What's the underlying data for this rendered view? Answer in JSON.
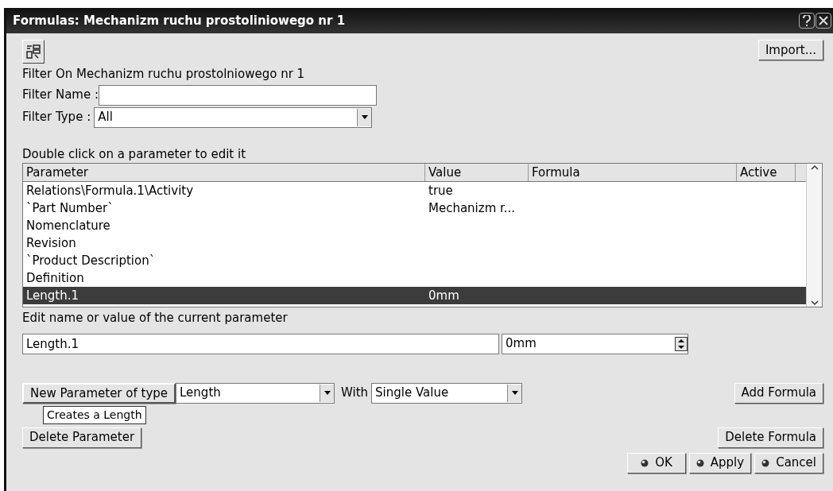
{
  "window": {
    "title": "Formulas: Mechanizm ruchu prostoliniowego nr 1"
  },
  "import_button": "Import...",
  "filter": {
    "heading": "Filter On Mechanizm ruchu prostolniowego nr 1",
    "name_label": "Filter Name :",
    "type_label": "Filter Type :",
    "type_value": "All"
  },
  "table": {
    "hint": "Double click on a parameter to edit it",
    "columns": [
      "Parameter",
      "Value",
      "Formula",
      "Active"
    ],
    "rows": [
      {
        "parameter": "Relations\\Formula.1\\Activity",
        "value": "true",
        "selected": false
      },
      {
        "parameter": "`Part Number`",
        "value": "Mechanizm r...",
        "selected": false
      },
      {
        "parameter": "Nomenclature",
        "selected": false
      },
      {
        "parameter": "Revision",
        "selected": false
      },
      {
        "parameter": "`Product Description`",
        "selected": false
      },
      {
        "parameter": "Definition",
        "selected": false
      },
      {
        "parameter": "Length.1",
        "value": "0mm",
        "selected": true
      }
    ]
  },
  "edit": {
    "label": "Edit name or value of the current parameter",
    "name_value": "Length.1",
    "value": "0mm"
  },
  "new_parameter": {
    "button": "New Parameter of type",
    "type_value": "Length",
    "with_label": "With",
    "with_value": "Single Value",
    "tooltip": "Creates a Length"
  },
  "delete_parameter": "Delete Parameter",
  "add_formula": "Add Formula",
  "delete_formula": "Delete Formula",
  "dialog_buttons": [
    "OK",
    "Apply",
    "Cancel"
  ]
}
